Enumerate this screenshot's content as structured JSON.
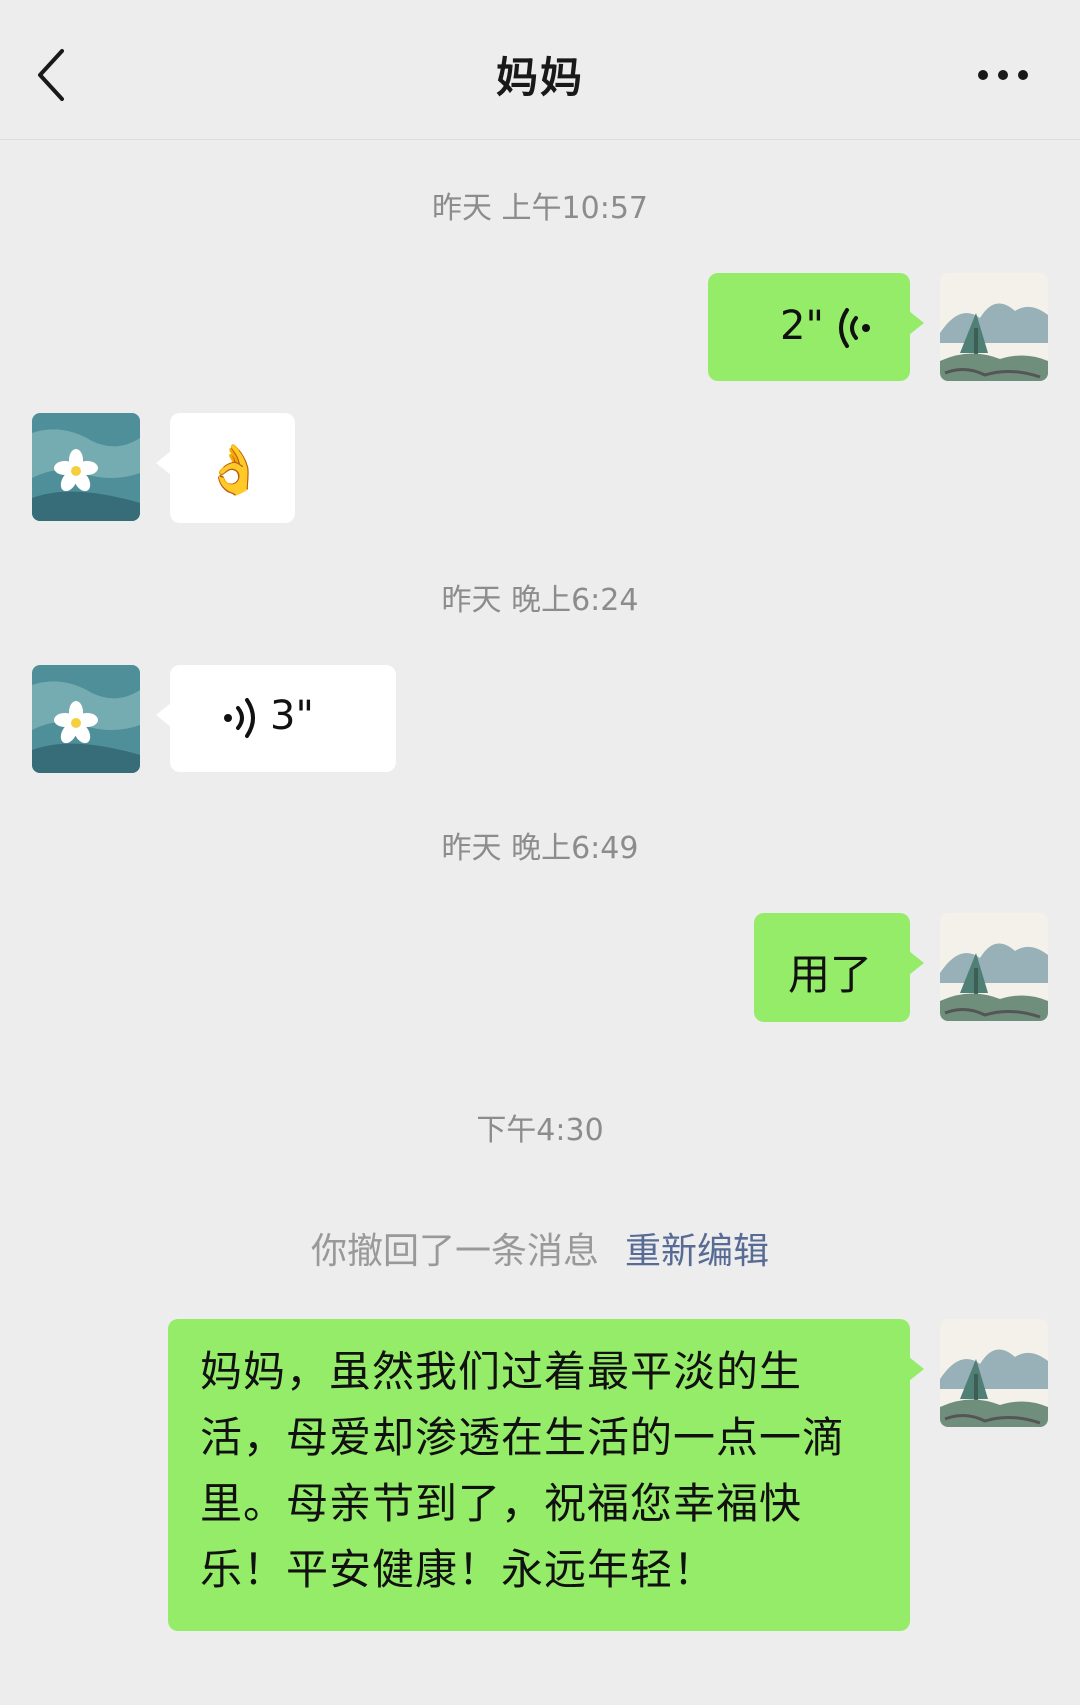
{
  "header": {
    "title": "妈妈",
    "back_icon": "chevron-left-icon",
    "more_icon": "more-dots-icon"
  },
  "messages": {
    "time1": "昨天 上午10:57",
    "voice_out_duration": "2\"",
    "emoji_in": "👌",
    "time2": "昨天 晚上6:24",
    "voice_in_duration": "3\"",
    "time3": "昨天 晚上6:49",
    "text_out_1": "用了",
    "time4": "下午4:30",
    "recall_notice": "你撤回了一条消息",
    "recall_edit": "重新编辑",
    "text_out_2": "妈妈，虽然我们过着最平淡的生活，母爱却渗透在生活的一点一滴里。母亲节到了，祝福您幸福快乐！平安健康！永远年轻！"
  },
  "colors": {
    "background": "#ededed",
    "outgoing_bubble": "#95ec69",
    "incoming_bubble": "#ffffff",
    "link": "#576b95"
  }
}
